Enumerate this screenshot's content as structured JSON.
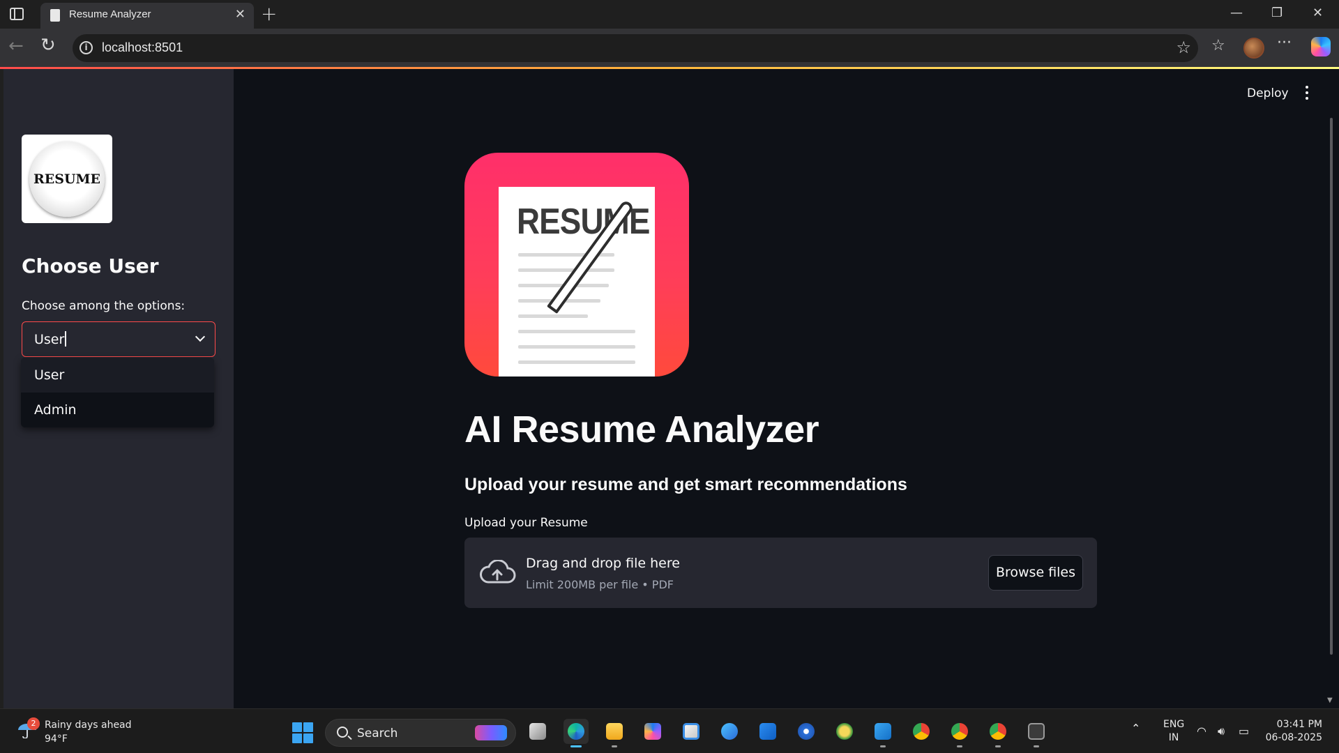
{
  "browser": {
    "tab_title": "Resume Analyzer",
    "url": "localhost:8501"
  },
  "sidebar": {
    "logo_text": "RESUME",
    "heading": "Choose User",
    "select_label": "Choose among the options:",
    "select_value": "User",
    "options": [
      "User",
      "Admin"
    ]
  },
  "header": {
    "deploy_label": "Deploy"
  },
  "main": {
    "hero_text": "RESUME",
    "title": "AI Resume Analyzer",
    "subtitle": "Upload your resume and get smart recommendations",
    "upload_label": "Upload your Resume",
    "dropzone_title": "Drag and drop file here",
    "dropzone_limit": "Limit 200MB per file • PDF",
    "browse_label": "Browse files"
  },
  "taskbar": {
    "weather_badge": "2",
    "weather_title": "Rainy days ahead",
    "weather_temp": "94°F",
    "search_placeholder": "Search",
    "lang_top": "ENG",
    "lang_bottom": "IN",
    "time": "03:41 PM",
    "date": "06-08-2025",
    "apps": [
      "task-view",
      "edge",
      "file-explorer",
      "copilot",
      "store",
      "teams",
      "outlook",
      "app-blue",
      "app-emblem",
      "vscode",
      "chrome",
      "chrome-profile-p",
      "chrome-profile-2",
      "terminal"
    ]
  },
  "colors": {
    "primary": "#ff4b4b",
    "app_bg": "#0e1117",
    "sidebar_bg": "#262730",
    "text": "#fafafa"
  }
}
